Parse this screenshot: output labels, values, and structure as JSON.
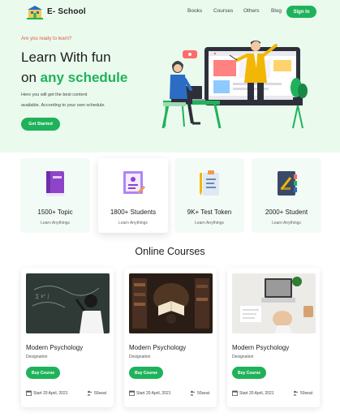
{
  "nav": {
    "brand": "E- School",
    "links": [
      "Books",
      "Courses",
      "Others",
      "Blog"
    ],
    "signin": "Sign In"
  },
  "hero": {
    "kicker": "Are you ready to learn?",
    "line1": "Learn With fun",
    "line2_prefix": "on ",
    "line2_accent": "any schedule",
    "sub1": "Here you will get the best content",
    "sub2": "available. According to your own schedule.",
    "cta": "Get Started"
  },
  "stats": [
    {
      "value": "1500+ Topic",
      "label": "Learn Anythings",
      "icon": "book-icon"
    },
    {
      "value": "1800+ Students",
      "label": "Learn Anythings",
      "icon": "certificate-icon"
    },
    {
      "value": "9K+ Test Token",
      "label": "Learn Anythings",
      "icon": "clipboard-icon"
    },
    {
      "value": "2000+ Student",
      "label": "Learn Anythings",
      "icon": "notebook-icon"
    }
  ],
  "section": {
    "title": "Online Courses"
  },
  "courses": [
    {
      "title": "Modern Psychology",
      "desc": "Designation",
      "button": "Buy Course",
      "date": "Start 20 April, 2021",
      "seats": "50seat"
    },
    {
      "title": "Modern Psychology",
      "desc": "Designation",
      "button": "Buy Course",
      "date": "Start 20 April, 2021",
      "seats": "50seat"
    },
    {
      "title": "Modern Psychology",
      "desc": "Designation",
      "button": "Buy Course",
      "date": "Start 20 April, 2021",
      "seats": "50seat"
    }
  ],
  "colors": {
    "accent": "#1fb25a",
    "hero_bg": "#eafbee",
    "kicker": "#e0584d"
  }
}
